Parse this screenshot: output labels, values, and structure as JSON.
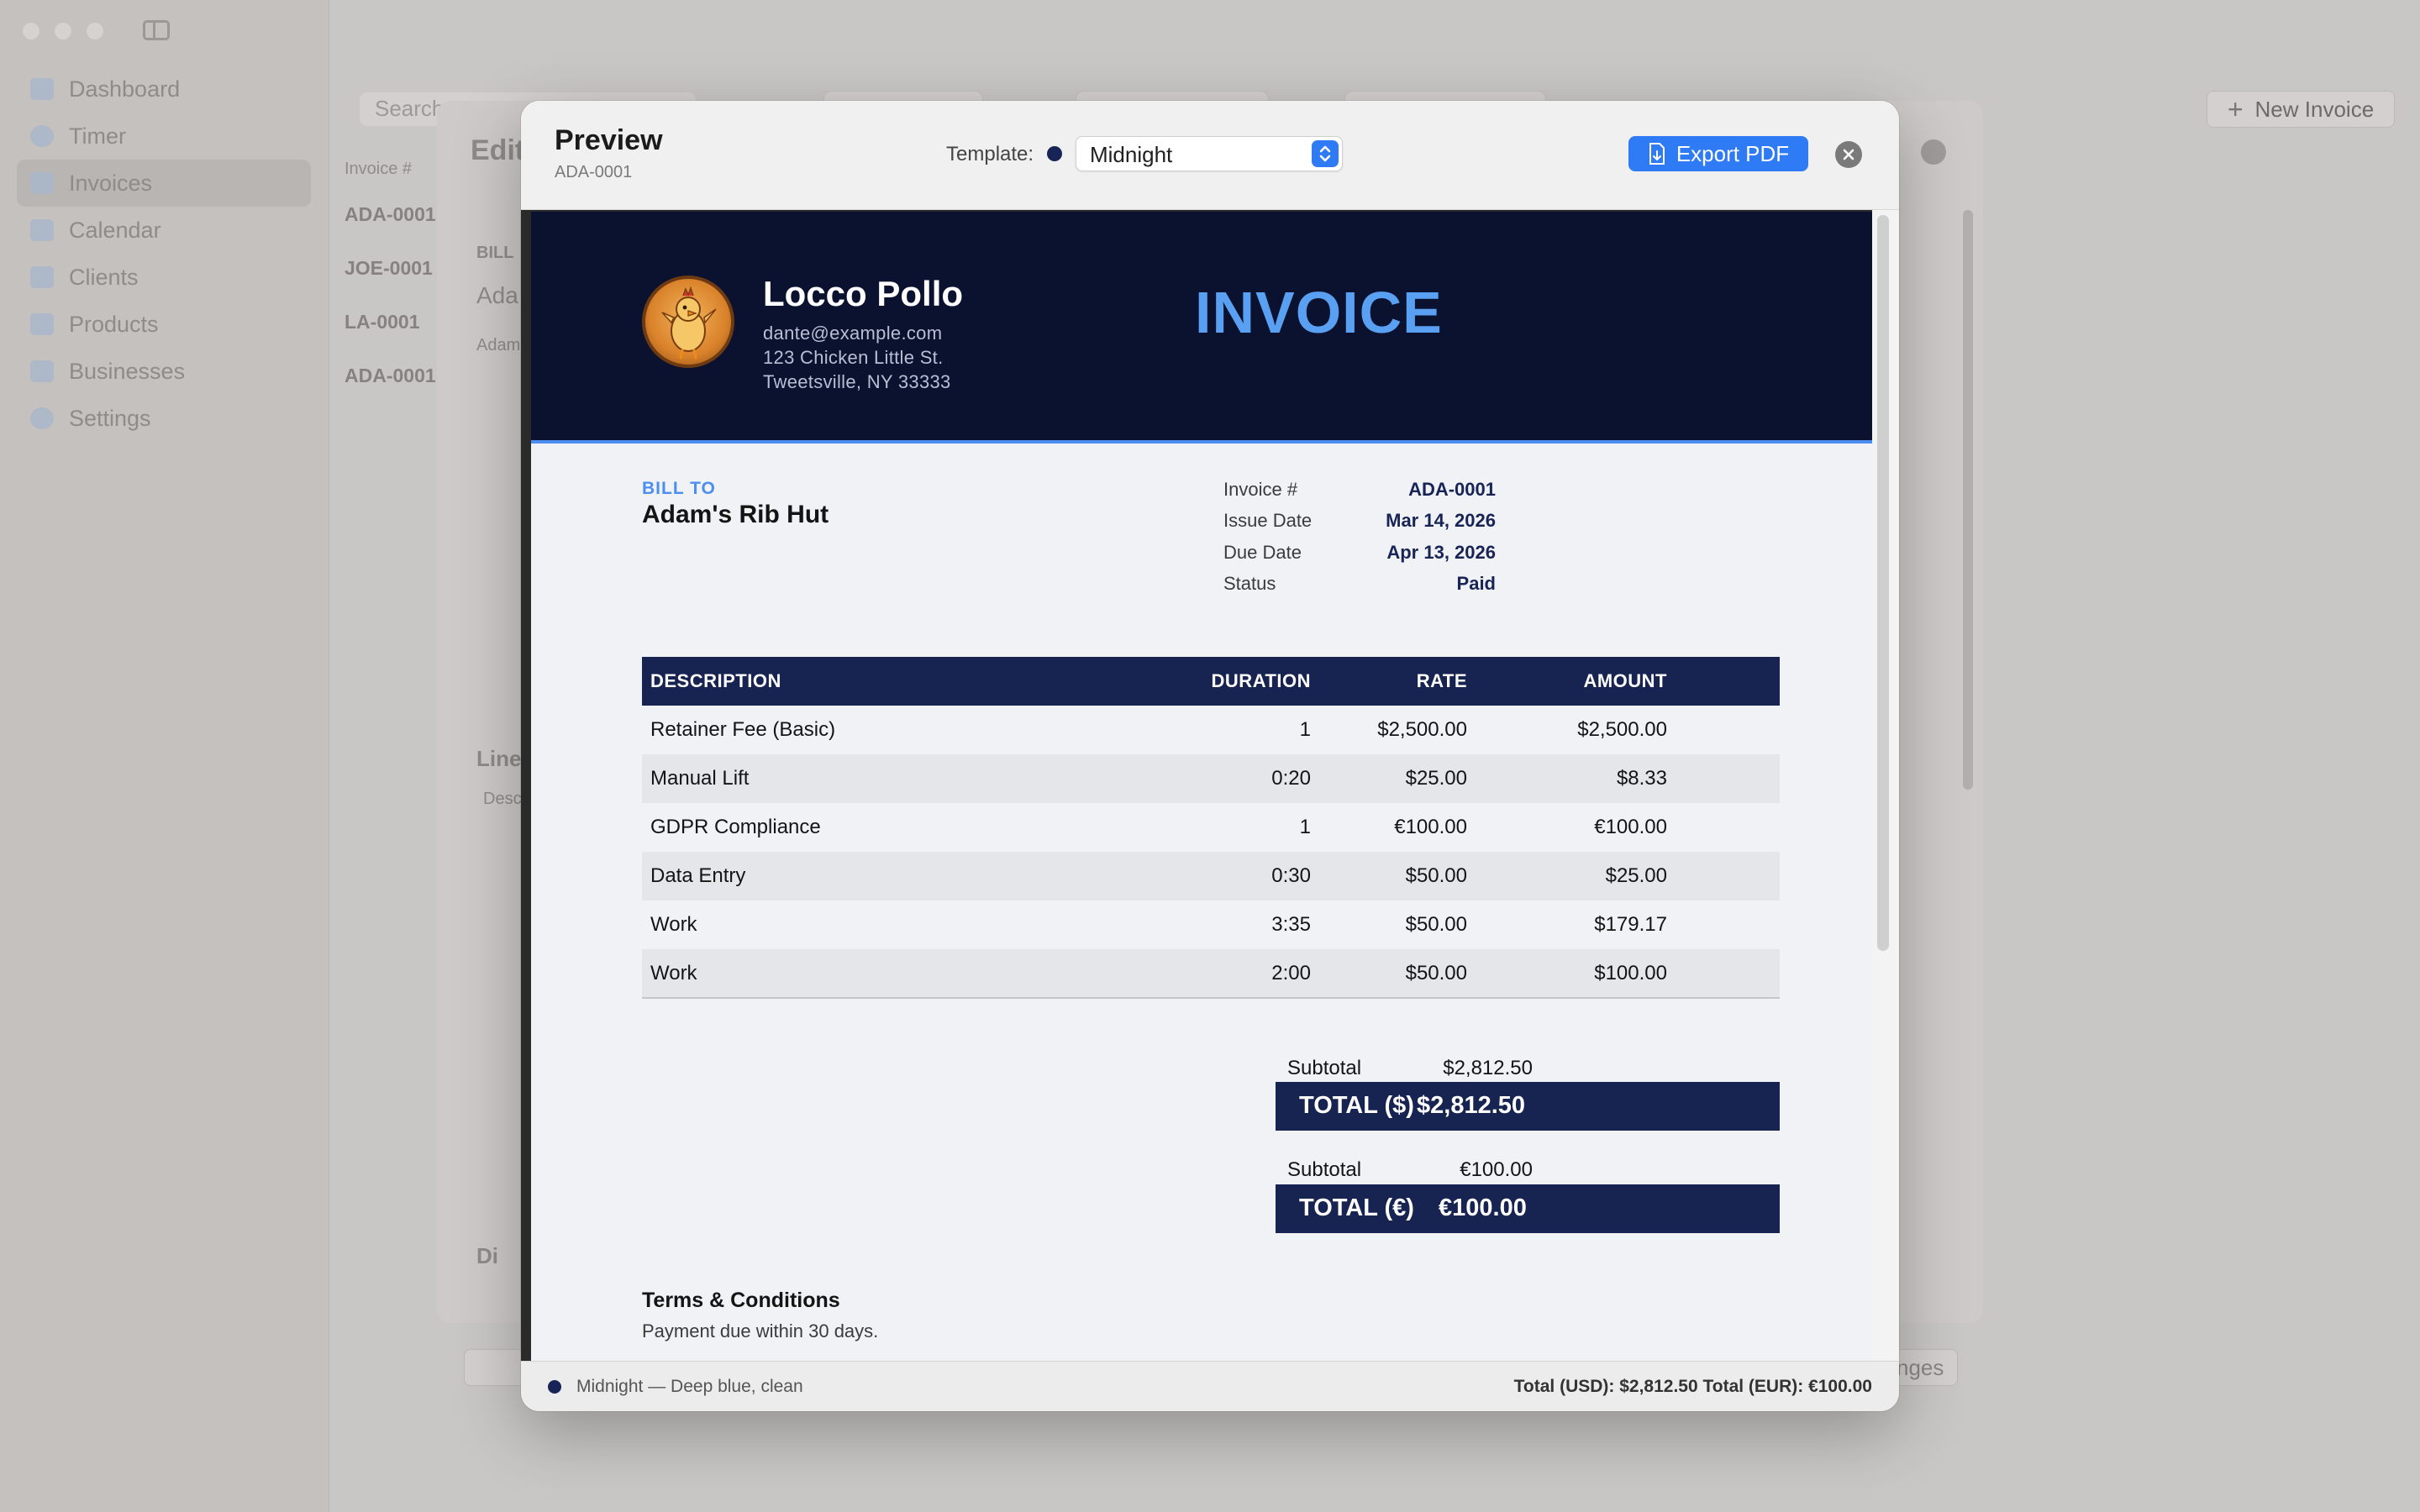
{
  "app": {
    "sidebar": {
      "items": [
        {
          "label": "Dashboard",
          "icon": "chart-bar-icon"
        },
        {
          "label": "Timer",
          "icon": "clock-icon"
        },
        {
          "label": "Invoices",
          "icon": "document-icon",
          "active": true
        },
        {
          "label": "Calendar",
          "icon": "calendar-icon"
        },
        {
          "label": "Clients",
          "icon": "people-icon"
        },
        {
          "label": "Products",
          "icon": "cube-icon"
        },
        {
          "label": "Businesses",
          "icon": "building-icon"
        },
        {
          "label": "Settings",
          "icon": "gear-icon"
        }
      ]
    },
    "toolbar": {
      "search_placeholder": "Search",
      "new_invoice_label": "New Invoice"
    },
    "list": {
      "header": "Invoice #",
      "rows": [
        "ADA-0001",
        "JOE-0001",
        "LA-0001",
        "ADA-0001"
      ]
    },
    "editor": {
      "title_partial": "Edit",
      "bill_to_partial": "BILL",
      "client_partial": "Ada",
      "client_sub_partial": "Adam",
      "line_items_partial": "Line",
      "desc_partial": "Desc",
      "discount_partial": "Di",
      "footer_right_partial": "nges"
    }
  },
  "modal": {
    "title": "Preview",
    "subtitle": "ADA-0001",
    "template_label": "Template:",
    "template_value": "Midnight",
    "template_color": "#182455",
    "export_label": "Export PDF",
    "status_left": "Midnight — Deep blue, clean",
    "status_right": "Total (USD): $2,812.50   Total (EUR): €100.00"
  },
  "invoice": {
    "business": {
      "name": "Locco Pollo",
      "email": "dante@example.com",
      "address1": "123 Chicken Little St.",
      "address2": "Tweetsville, NY 33333"
    },
    "heading": "INVOICE",
    "bill_to_label": "BILL TO",
    "client_name": "Adam's Rib Hut",
    "meta": {
      "number_label": "Invoice #",
      "number": "ADA-0001",
      "issue_label": "Issue Date",
      "issue": "Mar 14, 2026",
      "due_label": "Due Date",
      "due": "Apr 13, 2026",
      "status_label": "Status",
      "status": "Paid"
    },
    "columns": {
      "description": "DESCRIPTION",
      "duration": "DURATION",
      "rate": "RATE",
      "amount": "AMOUNT"
    },
    "items": [
      {
        "description": "Retainer Fee (Basic)",
        "duration": "1",
        "rate": "$2,500.00",
        "amount": "$2,500.00"
      },
      {
        "description": "Manual Lift",
        "duration": "0:20",
        "rate": "$25.00",
        "amount": "$8.33"
      },
      {
        "description": "GDPR Compliance",
        "duration": "1",
        "rate": "€100.00",
        "amount": "€100.00"
      },
      {
        "description": "Data Entry",
        "duration": "0:30",
        "rate": "$50.00",
        "amount": "$25.00"
      },
      {
        "description": "Work",
        "duration": "3:35",
        "rate": "$50.00",
        "amount": "$179.17"
      },
      {
        "description": "Work",
        "duration": "2:00",
        "rate": "$50.00",
        "amount": "$100.00"
      }
    ],
    "totals": {
      "usd_subtotal_label": "Subtotal",
      "usd_subtotal": "$2,812.50",
      "usd_total_label": "TOTAL ($)",
      "usd_total": "$2,812.50",
      "eur_subtotal_label": "Subtotal",
      "eur_subtotal": "€100.00",
      "eur_total_label": "TOTAL (€)",
      "eur_total": "€100.00"
    },
    "terms_heading": "Terms & Conditions",
    "terms_text": "Payment due within 30 days.",
    "colors": {
      "header_bg": "#0b1230",
      "accent": "#4c8ef0",
      "table_header": "#172350",
      "button": "#2f7bf6"
    }
  }
}
